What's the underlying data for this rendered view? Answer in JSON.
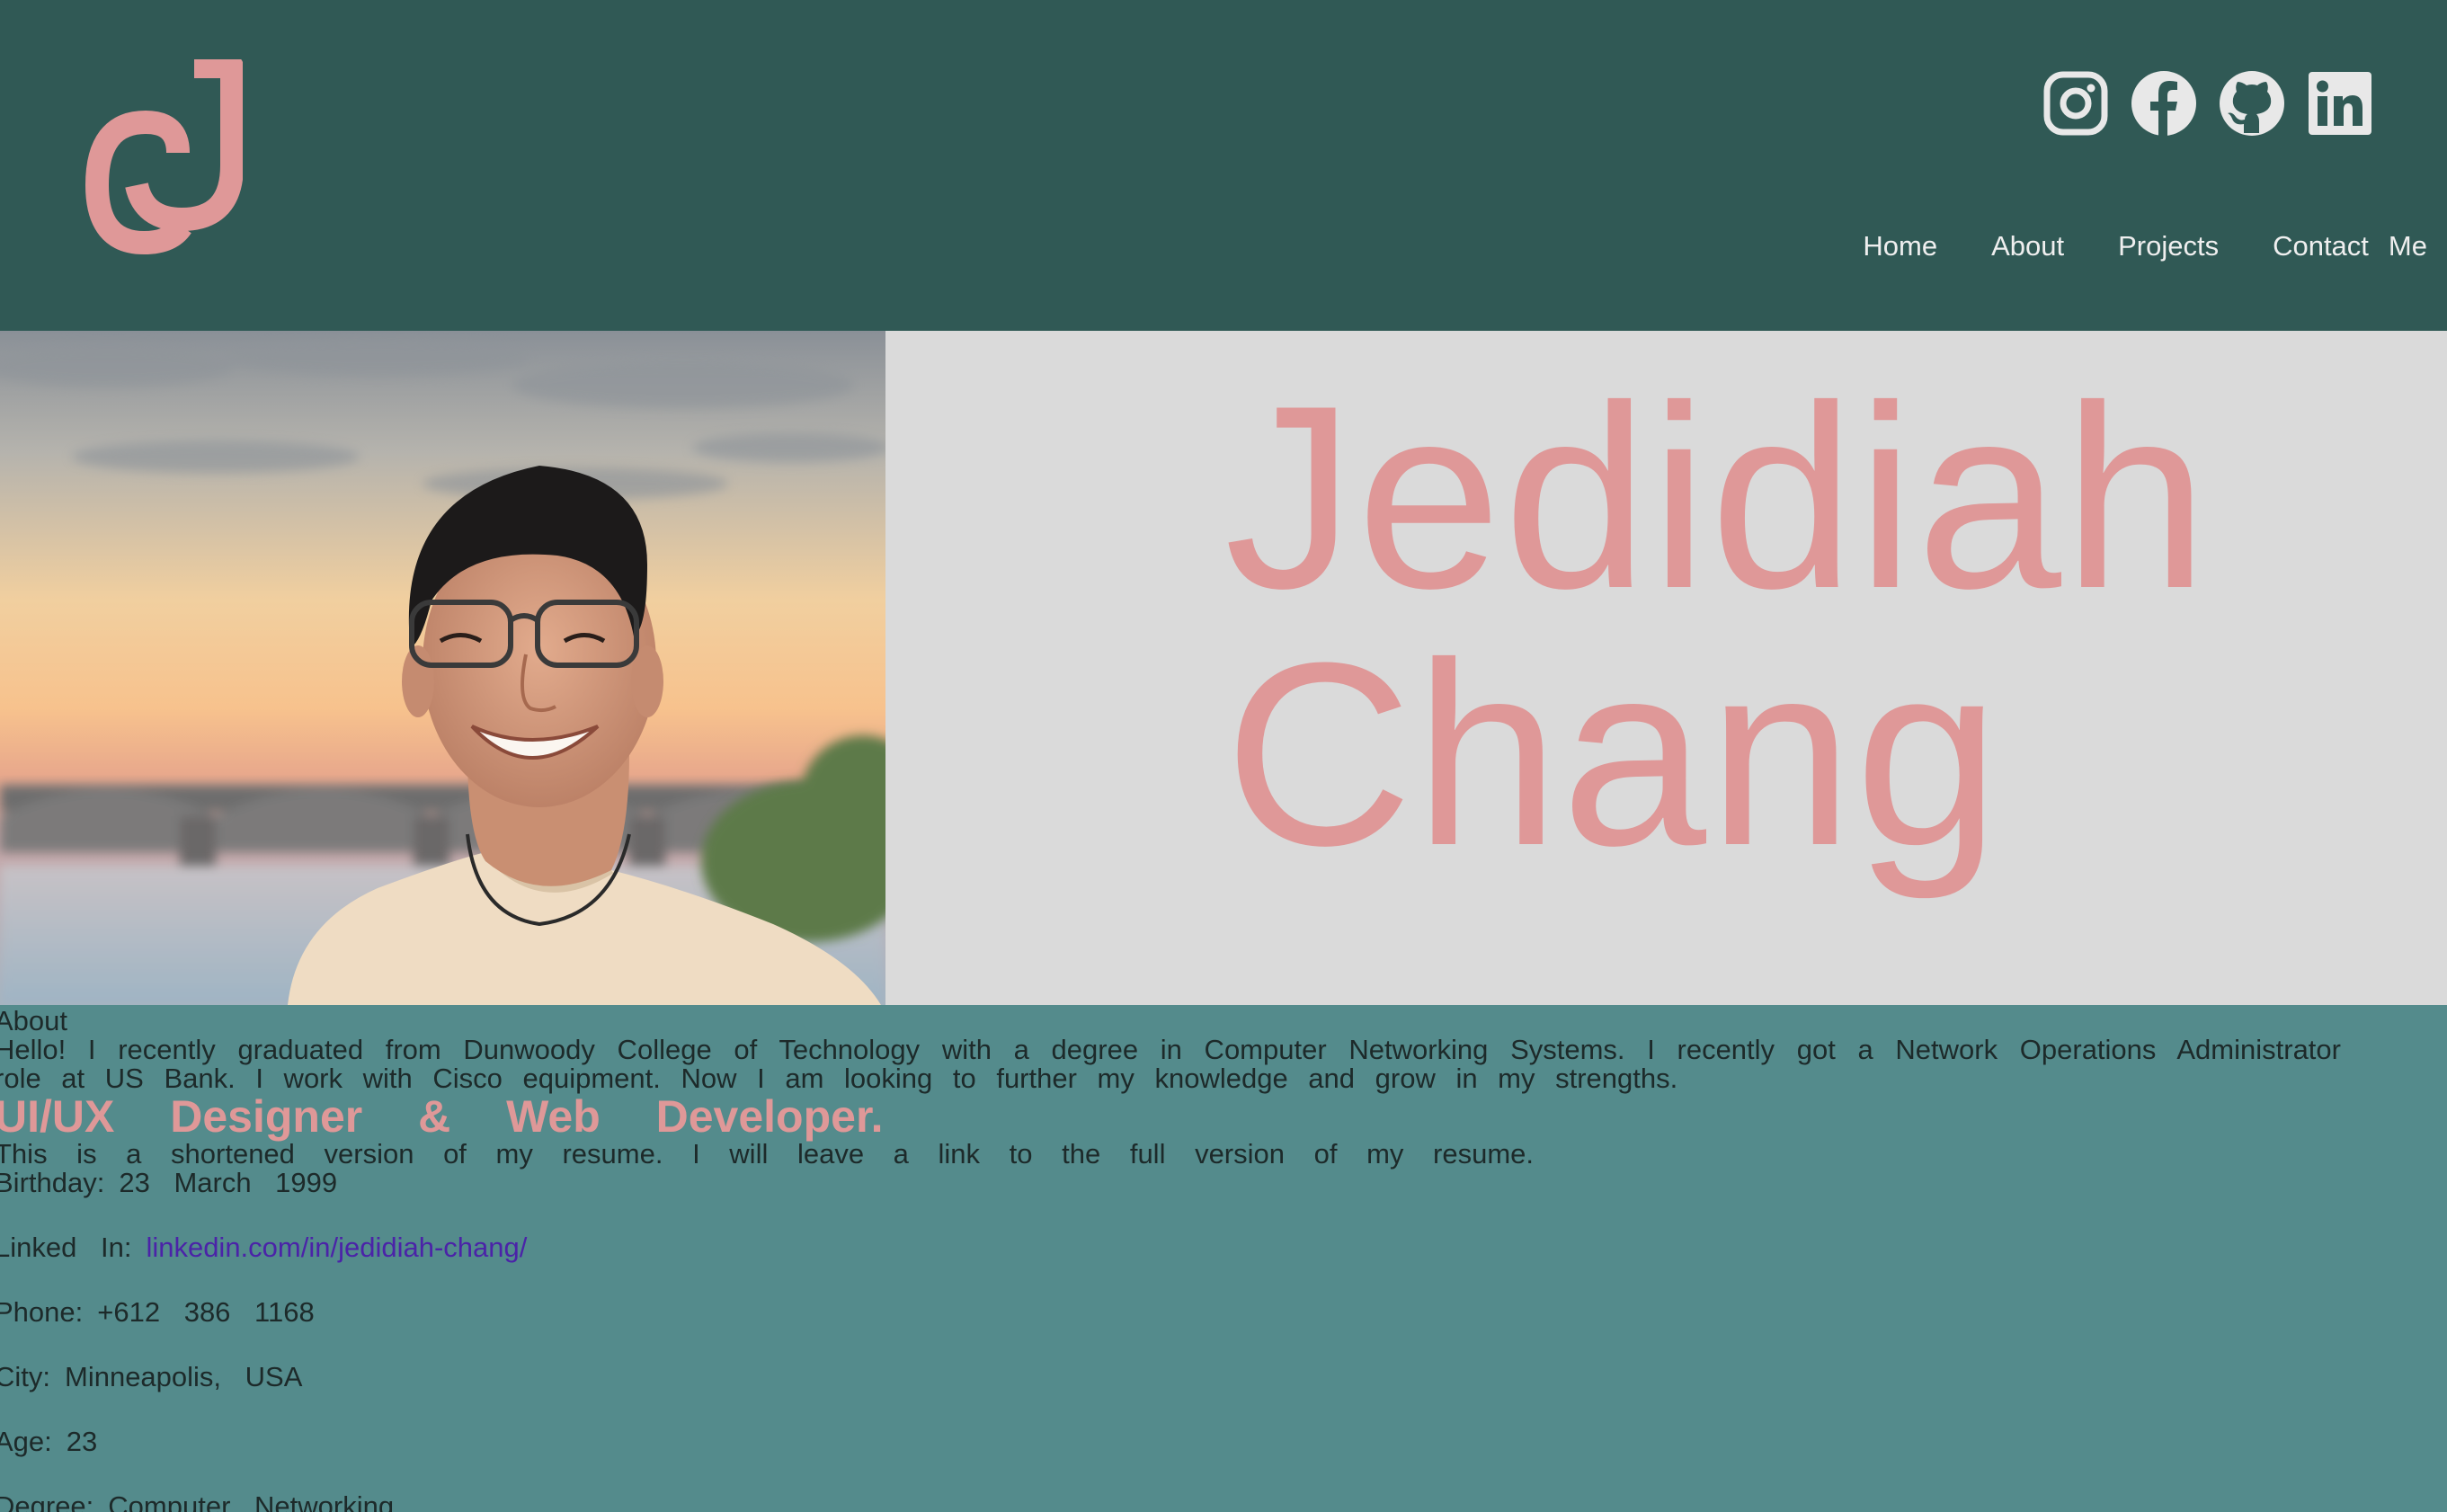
{
  "header": {
    "logo_name": "jc-monogram-logo",
    "social": [
      {
        "name": "instagram-icon"
      },
      {
        "name": "facebook-icon"
      },
      {
        "name": "github-icon"
      },
      {
        "name": "linkedin-icon"
      }
    ],
    "nav": [
      "Home",
      "About",
      "Projects",
      "Contact",
      "Me"
    ]
  },
  "hero": {
    "first_name": "Jedidiah",
    "last_name": "Chang"
  },
  "about": {
    "label": "About",
    "intro": "Hello! I recently graduated from Dunwoody College of Technology with a degree in Computer Networking Systems. I recently got a Network Operations Administrator role at US Bank. I work with Cisco equipment. Now I am looking to further my knowledge and grow in my strengths.",
    "title": "UI/UX Designer & Web Developer.",
    "resume_note": "This is a shortened version of my resume. I will leave a link to the full version of my resume.",
    "info": [
      {
        "label": "Birthday:",
        "value": "23 March 1999"
      },
      {
        "label": "Linked In:",
        "value": "linkedin.com/in/jedidiah-chang/"
      },
      {
        "label": "Phone:",
        "value": "+612 386 1168"
      },
      {
        "label": "City:",
        "value": "Minneapolis, USA"
      },
      {
        "label": "Age:",
        "value": "23"
      },
      {
        "label": "Degree:",
        "value": "Computer Networking"
      }
    ]
  },
  "colors": {
    "header_bg": "#305955",
    "hero_bg": "#dadada",
    "accent_pink": "#df9898",
    "about_bg": "#548b8c",
    "link": "#4b23a8"
  }
}
